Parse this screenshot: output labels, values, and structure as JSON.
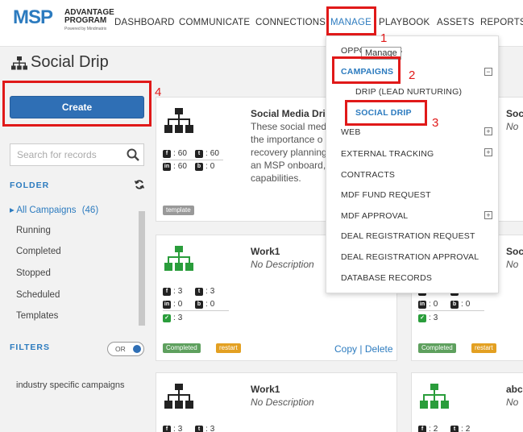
{
  "logo": {
    "msp": "MSP",
    "line1": "ADVANTAGE",
    "line2": "PROGRAM",
    "powered": "Powered by Mindmatrix"
  },
  "nav": {
    "items": [
      "DASHBOARD",
      "COMMUNICATE",
      "CONNECTIONS",
      "MANAGE",
      "PLAYBOOK",
      "ASSETS",
      "REPORTS"
    ],
    "active": "MANAGE"
  },
  "page": {
    "title": "Social Drip"
  },
  "sidebar": {
    "create_label": "Create",
    "search_placeholder": "Search for records",
    "folder_label": "FOLDER",
    "all_campaigns": "All Campaigns",
    "all_count": "(46)",
    "folders": [
      "Running",
      "Completed",
      "Stopped",
      "Scheduled",
      "Templates"
    ],
    "filters_label": "FILTERS",
    "toggle_label": "OR",
    "filter_items": [
      "industry specific campaigns"
    ]
  },
  "cards": [
    {
      "title": "Social Media Drip",
      "desc_lines": [
        "These social med",
        "the importance o",
        "recovery planning",
        "an MSP onboard,",
        "capabilities."
      ],
      "stats": [
        "60",
        "60",
        "60",
        "0"
      ],
      "badges": [
        "template"
      ],
      "icon_color": "#222222"
    },
    {
      "title": "Work1",
      "desc": "No Description",
      "stats": [
        "3",
        "3",
        "0",
        "0",
        "3"
      ],
      "badges": [
        "Completed",
        "restart"
      ],
      "actions": [
        "Copy",
        "|",
        "Delete"
      ],
      "icon_color": "#2a9d3b"
    },
    {
      "title": "Work1",
      "desc": "No Description",
      "stats": [
        "3",
        "3"
      ],
      "icon_color": "#222222"
    },
    {
      "title": "Soc",
      "desc": "No",
      "icon_color": "#222222"
    },
    {
      "title": "Soc",
      "desc": "No",
      "stats": [
        "3",
        "3",
        "0",
        "0",
        "3"
      ],
      "badges": [
        "Completed",
        "restart"
      ],
      "icon_color": "#2a9d3b"
    },
    {
      "title": "abc",
      "desc": "No",
      "stats": [
        "2",
        "2"
      ],
      "icon_color": "#2a9d3b"
    }
  ],
  "dropdown": {
    "opportunities": "OPPO",
    "opportunities_tail": "S",
    "campaigns": "CAMPAIGNS",
    "sub": [
      "DRIP (LEAD NURTURING)",
      "SOCIAL DRIP"
    ],
    "items": [
      "WEB",
      "EXTERNAL TRACKING",
      "CONTRACTS",
      "MDF FUND REQUEST",
      "MDF APPROVAL",
      "DEAL REGISTRATION REQUEST",
      "DEAL REGISTRATION APPROVAL",
      "DATABASE RECORDS"
    ],
    "tooltip": "Manage"
  },
  "annotations": [
    "1",
    "2",
    "3",
    "4"
  ],
  "colors": {
    "accent": "#2c7bbf",
    "button": "#2f6fb5",
    "annotation": "#e01919",
    "green": "#2a9d3b"
  }
}
